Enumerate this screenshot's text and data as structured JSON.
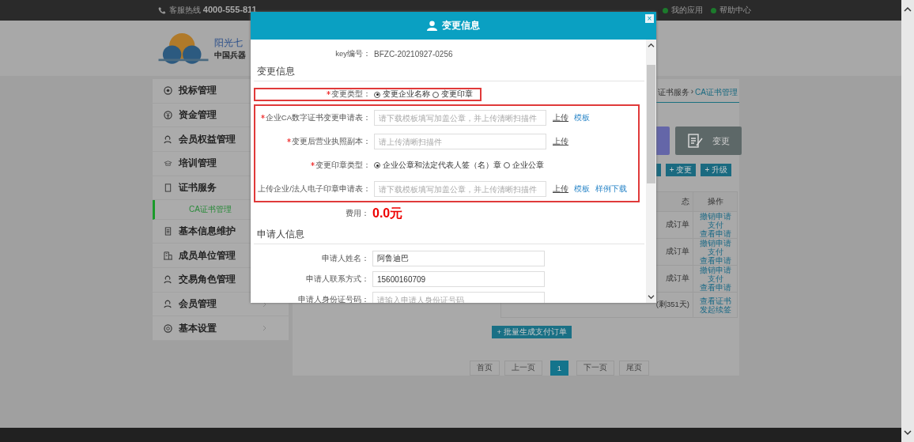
{
  "top_bar": {
    "hotline_label": "客服热线",
    "hotline": "4000-555-811",
    "links": [
      {
        "label": "我的应用"
      },
      {
        "label": "帮助中心"
      }
    ]
  },
  "logo": {
    "name": "阳光七",
    "subtitle": "中国兵器"
  },
  "sidebar": {
    "items": [
      {
        "label": "投标管理",
        "selected": false
      },
      {
        "label": "资金管理",
        "selected": false
      },
      {
        "label": "会员权益管理",
        "selected": false
      },
      {
        "label": "培训管理",
        "selected": false
      },
      {
        "label": "证书服务",
        "selected": false,
        "children": [
          {
            "label": "CA证书管理",
            "selected": true
          }
        ]
      },
      {
        "label": "基本信息维护",
        "selected": false
      },
      {
        "label": "成员单位管理",
        "selected": false
      },
      {
        "label": "交易角色管理",
        "selected": false
      },
      {
        "label": "会员管理",
        "selected": false
      },
      {
        "label": "基本设置",
        "selected": false
      }
    ]
  },
  "breadcrumb": {
    "separator": "›",
    "items": [
      "证书服务",
      "CA证书管理"
    ]
  },
  "action_tile": {
    "label": "变更"
  },
  "toolbar_buttons": [
    "+ 变更",
    "+ 升级"
  ],
  "table": {
    "columns": [
      "态",
      "操作"
    ],
    "rows": [
      {
        "status": "成订单",
        "actions": [
          "撤销申请",
          "支付",
          "查看申请"
        ]
      },
      {
        "status": "成订单",
        "actions": [
          "撤销申请",
          "支付",
          "查看申请"
        ]
      },
      {
        "status": "成订单",
        "actions": [
          "撤销申请",
          "支付",
          "查看申请"
        ]
      },
      {
        "status": "(剩351天)",
        "actions": [
          "查看证书",
          "发起续签"
        ]
      }
    ]
  },
  "batch_button": "+ 批量生成支付订单",
  "pagination": [
    {
      "label": "首页",
      "selected": false
    },
    {
      "label": "上一页",
      "selected": false
    },
    {
      "label": "1",
      "selected": true
    },
    {
      "label": "下一页",
      "selected": false
    },
    {
      "label": "尾页",
      "selected": false
    }
  ],
  "modal": {
    "title": "变更信息",
    "close": "×",
    "key_label": "key编号：",
    "key_value": "BFZC-20210927-0256",
    "change_section": {
      "title": "变更信息",
      "type_field": {
        "label": "变更类型：",
        "required": true,
        "highlighted": true,
        "options": [
          {
            "label": "变更企业名称",
            "selected": true
          },
          {
            "label": "变更印章",
            "selected": false
          }
        ]
      },
      "fields_highlighted": true,
      "fields": [
        {
          "kind": "upload",
          "label": "企业CA数字证书变更申请表：",
          "required": true,
          "placeholder": "请下载模板填写加盖公章，并上传清晰扫描件",
          "links": [
            {
              "kind": "upload",
              "label": "上传"
            },
            {
              "kind": "link",
              "label": "模板"
            }
          ]
        },
        {
          "kind": "upload",
          "label": "变更后营业执照副本：",
          "required": true,
          "placeholder": "请上传清晰扫描件",
          "links": [
            {
              "kind": "upload",
              "label": "上传"
            }
          ]
        },
        {
          "kind": "radio",
          "label": "变更印章类型：",
          "required": true,
          "options": [
            {
              "label": "企业公章和法定代表人签（名）章",
              "selected": true
            },
            {
              "label": "企业公章",
              "selected": false
            }
          ]
        },
        {
          "kind": "upload",
          "label": "上传企业/法人电子印章申请表：",
          "required": false,
          "placeholder": "请下载模板填写加盖公章，并上传清晰扫描件",
          "links": [
            {
              "kind": "upload",
              "label": "上传"
            },
            {
              "kind": "link",
              "label": "模板"
            },
            {
              "kind": "link",
              "label": "样例下载"
            }
          ]
        }
      ]
    },
    "fee": {
      "label": "费用：",
      "value": "0.0元"
    },
    "applicant_section": {
      "title": "申请人信息",
      "fields": [
        {
          "label": "申请人姓名：",
          "value": "阿鲁迪巴"
        },
        {
          "label": "申请人联系方式：",
          "value": "15600160709"
        },
        {
          "label": "申请人身份证号码：",
          "placeholder": "请输入申请人身份证号码"
        }
      ]
    }
  }
}
